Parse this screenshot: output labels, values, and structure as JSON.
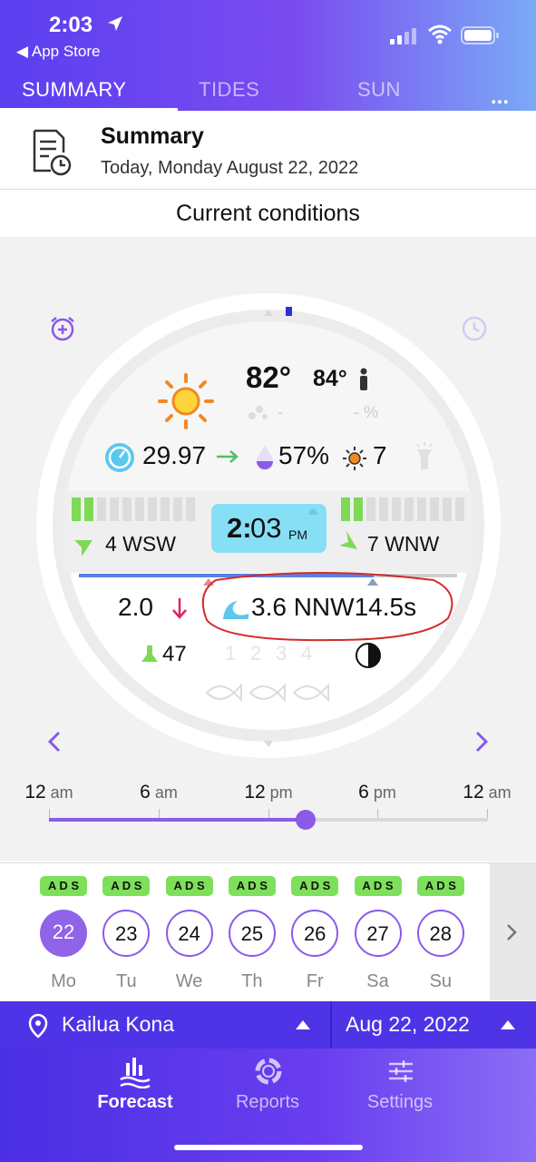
{
  "status_bar": {
    "time": "2:03",
    "back_label": "◀ App Store"
  },
  "tabs": [
    {
      "label": "SUMMARY",
      "active": true
    },
    {
      "label": "TIDES",
      "active": false
    },
    {
      "label": "SUN",
      "active": false
    }
  ],
  "more_label": "...",
  "header": {
    "title": "Summary",
    "subtitle": "Today, Monday August 22, 2022"
  },
  "section_title": "Current conditions",
  "weather": {
    "temperature": "82°",
    "feels_like": "84°",
    "rain_value": "-",
    "rain_percent": "- %",
    "pressure": "29.97",
    "humidity": "57%",
    "uv_index": "7",
    "wind_left": "4 WSW",
    "wind_right": "7 WNW",
    "time_hour": "2:",
    "time_minutes": "03",
    "time_period": "PM",
    "tide_height": "2.0",
    "swell": "3.6 NNW14.5s",
    "water_temp": "47",
    "fish_rating_labels": [
      "1",
      "2",
      "3",
      "4"
    ],
    "wind_left_bars_active": 2,
    "wind_right_bars_active": 2,
    "wind_bars_total": 10
  },
  "timeline": {
    "labels": [
      {
        "num": "12",
        "unit": "am"
      },
      {
        "num": "6",
        "unit": "am"
      },
      {
        "num": "12",
        "unit": "pm"
      },
      {
        "num": "6",
        "unit": "pm"
      },
      {
        "num": "12",
        "unit": "am"
      }
    ],
    "progress": 0.585
  },
  "days": {
    "ads_label": "A D S",
    "items": [
      {
        "num": "22",
        "dow": "Mo",
        "selected": true
      },
      {
        "num": "23",
        "dow": "Tu",
        "selected": false
      },
      {
        "num": "24",
        "dow": "We",
        "selected": false
      },
      {
        "num": "25",
        "dow": "Th",
        "selected": false
      },
      {
        "num": "26",
        "dow": "Fr",
        "selected": false
      },
      {
        "num": "27",
        "dow": "Sa",
        "selected": false
      },
      {
        "num": "28",
        "dow": "Su",
        "selected": false
      }
    ]
  },
  "location": {
    "name": "Kailua Kona",
    "date": "Aug 22, 2022"
  },
  "bottom_nav": [
    {
      "label": "Forecast",
      "icon": "forecast-icon",
      "active": true
    },
    {
      "label": "Reports",
      "icon": "reports-icon",
      "active": false
    },
    {
      "label": "Settings",
      "icon": "settings-icon",
      "active": false
    }
  ],
  "colors": {
    "accent": "#7a4cf0",
    "wind_green": "#7ed957",
    "swell_blue": "#5cc8ee",
    "time_box": "#86dff5",
    "tide_down": "#e0245e",
    "annotation_red": "#d22b2b"
  }
}
